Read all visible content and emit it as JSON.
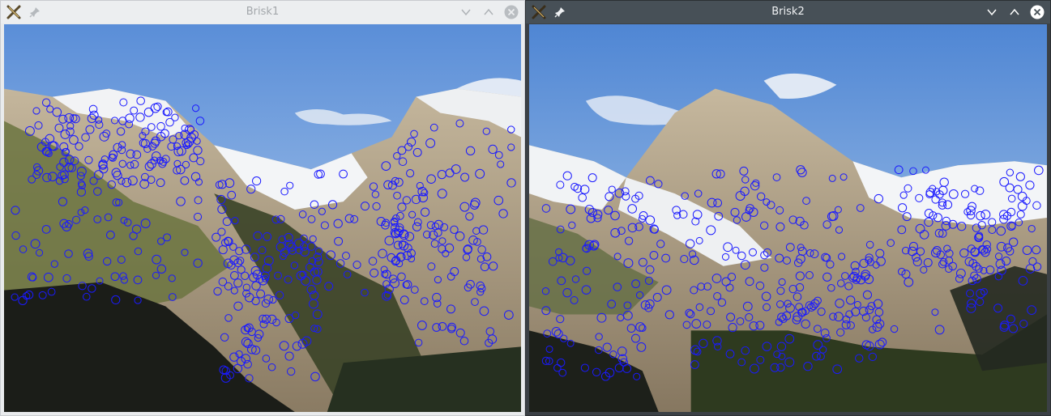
{
  "windows": [
    {
      "title": "Brisk1",
      "active": false
    },
    {
      "title": "Brisk2",
      "active": true
    }
  ],
  "icons": {
    "app": "x-app-icon",
    "pin": "pin-icon",
    "minimize": "chevron-down-icon",
    "maximize": "chevron-up-icon",
    "close": "close-circle-icon"
  },
  "colors": {
    "keypoint": "#1a1aff",
    "sky_top": "#5b8fd8",
    "sky_bottom": "#b7d2ee",
    "rock": "#b3a58e",
    "snow": "#f3f4f6",
    "forest": "#2e3a1f",
    "shadow": "#1b1d18"
  }
}
